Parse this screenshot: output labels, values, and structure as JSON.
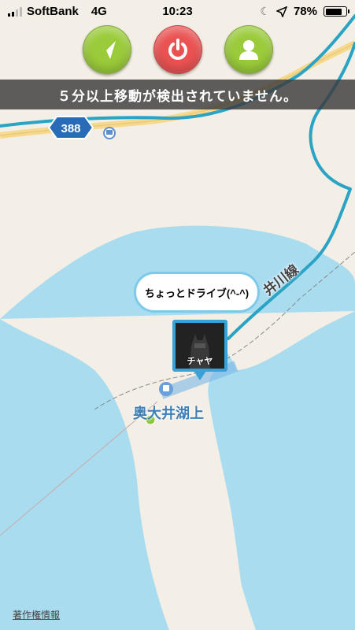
{
  "status_bar": {
    "carrier": "SoftBank",
    "network": "4G",
    "time": "10:23",
    "battery": "78%",
    "battery_level": 0.78,
    "icons": [
      "moon-icon",
      "location-arrow-icon"
    ]
  },
  "controls": {
    "nav_button_icon": "navigation-arrow-icon",
    "power_button_icon": "power-icon",
    "user_button_icon": "user-icon"
  },
  "banner": {
    "message": "５分以上移動が検出されていません。"
  },
  "map": {
    "route_badge": "388",
    "route_line_label": "井川線",
    "station_name": "奥大井湖上",
    "credits_link": "著作権情報",
    "colors": {
      "water": "#aadcf0",
      "land": "#f4efe6",
      "route_line": "#2ba3c4",
      "road": "#f7d98e"
    }
  },
  "marker": {
    "bubble_text": "ちょっとドライブ(^-^)",
    "user_name": "チャヤ"
  }
}
